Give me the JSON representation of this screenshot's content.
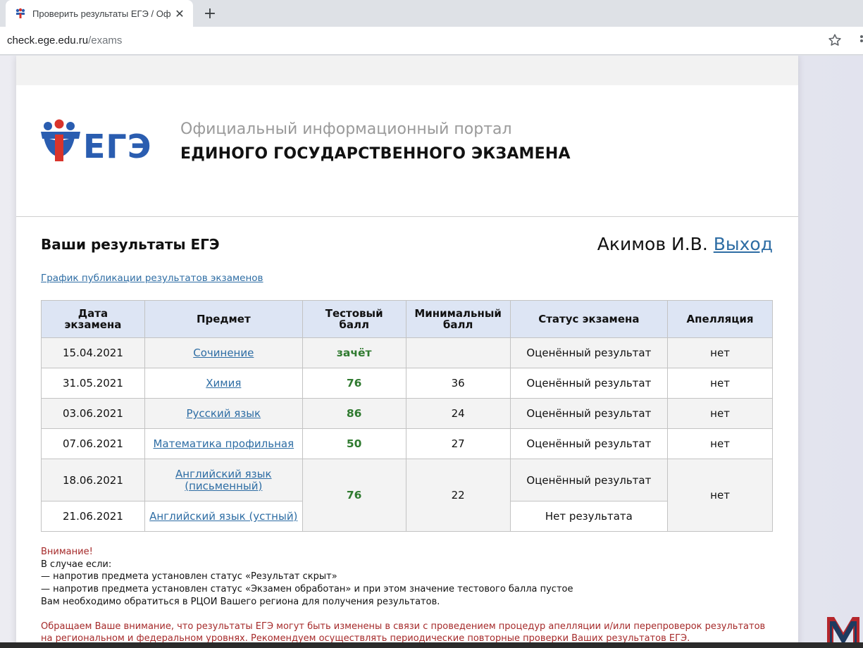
{
  "browser": {
    "tab_title": "Проверить результаты ЕГЭ / Оф",
    "url_host": "check.ege.edu.ru",
    "url_path": "/exams"
  },
  "header": {
    "logo_text": "ЕГЭ",
    "portal_line1": "Официальный информационный портал",
    "portal_line2": "ЕДИНОГО ГОСУДАРСТВЕННОГО ЭКЗАМЕНА"
  },
  "main": {
    "title": "Ваши результаты ЕГЭ",
    "user_name": "Акимов И.В.",
    "logout": "Выход",
    "schedule_link": "График публикации результатов экзаменов"
  },
  "table": {
    "headers": [
      "Дата экзамена",
      "Предмет",
      "Тестовый балл",
      "Минимальный балл",
      "Статус экзамена",
      "Апелляция"
    ],
    "rows": [
      {
        "date": "15.04.2021",
        "subject": "Сочинение",
        "score": "зачёт",
        "min": "",
        "status": "Оценённый результат",
        "appeal": "нет"
      },
      {
        "date": "31.05.2021",
        "subject": "Химия",
        "score": "76",
        "min": "36",
        "status": "Оценённый результат",
        "appeal": "нет"
      },
      {
        "date": "03.06.2021",
        "subject": "Русский язык",
        "score": "86",
        "min": "24",
        "status": "Оценённый результат",
        "appeal": "нет"
      },
      {
        "date": "07.06.2021",
        "subject": "Математика профильная",
        "score": "50",
        "min": "27",
        "status": "Оценённый результат",
        "appeal": "нет"
      },
      {
        "date": "18.06.2021",
        "subject": "Английский язык (письменный)",
        "score": "76",
        "min": "22",
        "status": "Оценённый результат",
        "appeal": "нет"
      },
      {
        "date": "21.06.2021",
        "subject": "Английский язык (устный)",
        "status": "Нет результата"
      }
    ]
  },
  "notes": {
    "attention": "Внимание!",
    "line1": "В случае если:",
    "line2": "— напротив предмета установлен статус «Результат скрыт»",
    "line3": "— напротив предмета установлен статус «Экзамен обработан» и при этом значение тестового балла пустое",
    "line4": "Вам необходимо обратиться в РЦОИ Вашего региона для получения результатов.",
    "warning1": "Обращаем Ваше внимание, что результаты ЕГЭ могут быть изменены в связи с проведением процедур апелляции и/или перепроверок результатов",
    "warning2": "на региональном и федеральном уровнях. Рекомендуем осуществлять периодические повторные проверки Ваших результатов ЕГЭ."
  },
  "colors": {
    "link": "#2e6da4",
    "score": "#2f7a2f",
    "header_bg": "#dde5f4",
    "warning": "#a52a2a"
  }
}
